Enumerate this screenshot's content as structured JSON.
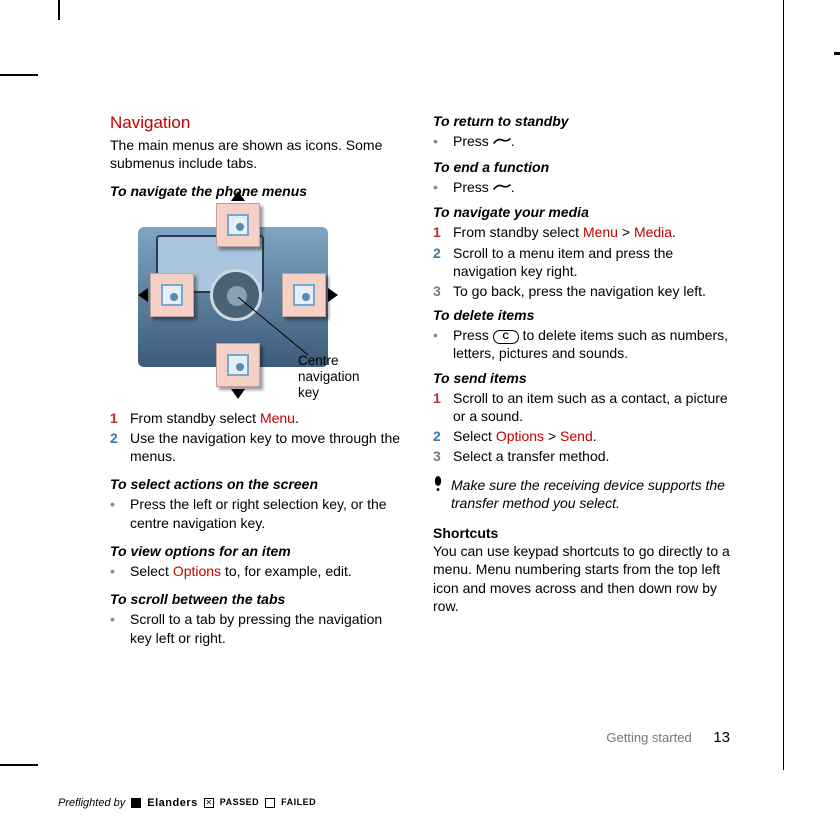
{
  "heading": "Navigation",
  "intro": "The main menus are shown as icons. Some submenus include tabs.",
  "sub_navigate": "To navigate the phone menus",
  "fig_caption_l1": "Centre navigation",
  "fig_caption_l2": "key",
  "nav_steps": {
    "s1a": "From standby select ",
    "s1b": "Menu",
    "s1c": ".",
    "s2": "Use the navigation key to move through the menus."
  },
  "sub_select": "To select actions on the screen",
  "select_b": "Press the left or right selection key, or the centre navigation key.",
  "sub_view": "To view options for an item",
  "view_a": "Select ",
  "view_b": "Options",
  "view_c": " to, for example, edit.",
  "sub_scroll": "To scroll between the tabs",
  "scroll_b": "Scroll to a tab by pressing the navigation key left or right.",
  "sub_return": "To return to standby",
  "return_a": "Press ",
  "return_b": ".",
  "sub_end": "To end a function",
  "end_a": "Press ",
  "end_b": ".",
  "sub_navmedia": "To navigate your media",
  "nm1a": "From standby select ",
  "nm1b": "Menu",
  "nm1c": " > ",
  "nm1d": "Media",
  "nm1e": ".",
  "nm2": "Scroll to a menu item and press the navigation key right.",
  "nm3": "To go back, press the navigation key left.",
  "sub_delete": "To delete items",
  "del_a": "Press ",
  "del_key": "C",
  "del_b": " to delete items such as numbers, letters, pictures and sounds.",
  "sub_send": "To send items",
  "send1": "Scroll to an item such as a contact, a picture or a sound.",
  "send2a": "Select ",
  "send2b": "Options",
  "send2c": " > ",
  "send2d": "Send",
  "send2e": ".",
  "send3": "Select a transfer method.",
  "note": "Make sure the receiving device supports the transfer method you select.",
  "shortcuts_h": "Shortcuts",
  "shortcuts_b": "You can use keypad shortcuts to go directly to a menu. Menu numbering starts from the top left icon and moves across and then down row by row.",
  "footer_section": "Getting started",
  "page_number": "13",
  "preflight_by": "Preflighted by",
  "brand": "Elanders",
  "passed": "PASSED",
  "failed": "FAILED",
  "x": "✕"
}
